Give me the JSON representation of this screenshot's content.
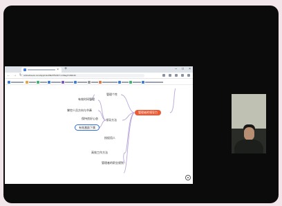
{
  "browser": {
    "tab_close": "×",
    "new_tab": "+",
    "window_controls": [
      "–",
      "□",
      "×"
    ],
    "nav_buttons": [
      "←",
      "→",
      "↻"
    ],
    "url": "onlinebreeze.com/app/mind/8e375c4b?-1-b6ag7c40dc1b"
  },
  "mindmap": {
    "root": "管理者的领导力",
    "topics": [
      {
        "label": "管理个性",
        "children": [
          "有效时间管理"
        ]
      },
      {
        "label": "领导方法",
        "children": [
          "掌控人员方向与节奏",
          "保持良好心态",
          "有效激励下属"
        ]
      },
      {
        "label": "授权用人",
        "children": []
      },
      {
        "label": "高效工作方法",
        "children": []
      },
      {
        "label": "管理者的职业规划",
        "children": []
      }
    ],
    "selected_node": "有效激励下属"
  },
  "colors": {
    "root_fill": "#ec5a34",
    "selection_border": "#2f6fd6",
    "connector": "#b9a6d9",
    "root_connector": "#ec5a34"
  },
  "icons": {
    "settings": "gear-icon"
  }
}
